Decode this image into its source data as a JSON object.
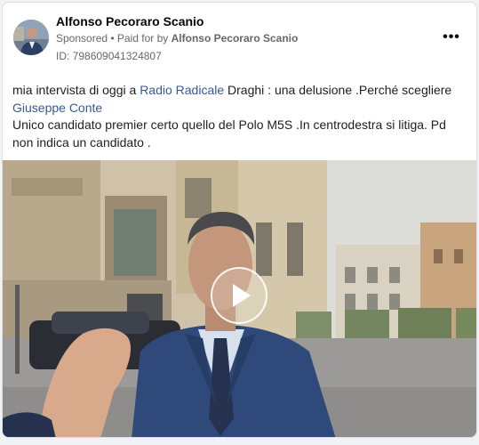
{
  "post": {
    "author_name": "Alfonso Pecoraro Scanio",
    "sponsored_label": "Sponsored",
    "separator": " • ",
    "paid_for_prefix": "Paid for by ",
    "paid_for_name": "Alfonso Pecoraro Scanio",
    "ad_id": "ID: 798609041324807",
    "more_options_icon": "more-horizontal-icon",
    "more_label": "•••"
  },
  "body": {
    "line1_part1": "mia intervista di oggi a ",
    "link1": "Radio Radicale",
    "line1_part2": " Draghi : una delusione .Perché scegliere ",
    "link2": "Giuseppe Conte",
    "line3": "Unico candidato premier certo quello del Polo M5S .In centrodestra si litiga. Pd non indica un candidato ."
  },
  "media": {
    "type": "video",
    "play_icon": "play-icon"
  },
  "colors": {
    "link": "#385898",
    "secondary_text": "#65676b",
    "card_border": "#dddfe2"
  }
}
